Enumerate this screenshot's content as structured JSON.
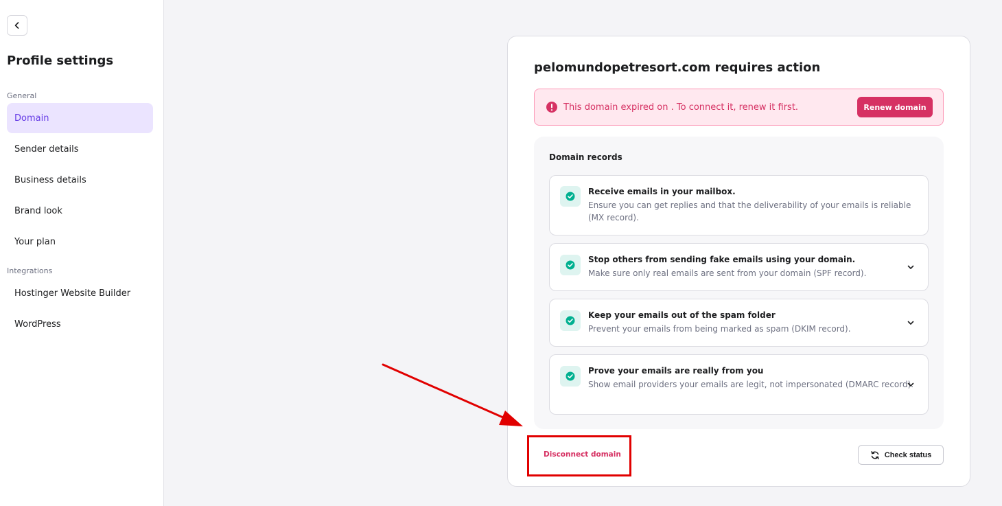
{
  "sidebar": {
    "back_icon": "chevron-left-icon",
    "title": "Profile settings",
    "sections": [
      {
        "label": "General",
        "items": [
          {
            "label": "Domain",
            "active": true
          },
          {
            "label": "Sender details",
            "active": false
          },
          {
            "label": "Business details",
            "active": false
          },
          {
            "label": "Brand look",
            "active": false
          },
          {
            "label": "Your plan",
            "active": false
          }
        ]
      },
      {
        "label": "Integrations",
        "items": [
          {
            "label": "Hostinger Website Builder",
            "active": false
          },
          {
            "label": "WordPress",
            "active": false
          }
        ]
      }
    ]
  },
  "card": {
    "title": "pelomundopetresort.com requires action",
    "alert": {
      "icon": "exclamation-circle-icon",
      "text": "This domain expired on . To connect it, renew it first.",
      "button_label": "Renew domain"
    },
    "records": {
      "title": "Domain records",
      "items": [
        {
          "title": "Receive emails in your mailbox.",
          "description": "Ensure you can get replies and that the deliverability of your emails is reliable (MX record).",
          "status": "verified",
          "expandable": false
        },
        {
          "title": "Stop others from sending fake emails using your domain.",
          "description": "Make sure only real emails are sent from your domain (SPF record).",
          "status": "verified",
          "expandable": true
        },
        {
          "title": "Keep your emails out of the spam folder",
          "description": "Prevent your emails from being marked as spam (DKIM record).",
          "status": "verified",
          "expandable": true
        },
        {
          "title": "Prove your emails are really from you",
          "description": "Show email providers your emails are legit, not impersonated (DMARC record).",
          "status": "verified",
          "expandable": true
        }
      ]
    },
    "disconnect_label": "Disconnect domain",
    "check_status_label": "Check status",
    "check_status_icon": "refresh-icon"
  },
  "colors": {
    "accent": "#673de6",
    "accent_bg": "#ebe4ff",
    "danger": "#d63163",
    "danger_bg": "#ffe8ef",
    "success": "#00b090",
    "success_bg": "#def4f0",
    "annotation": "#e10000"
  }
}
